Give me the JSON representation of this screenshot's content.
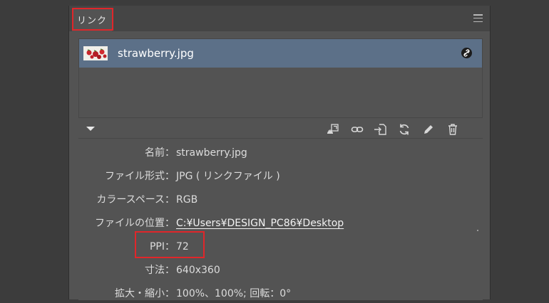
{
  "panel": {
    "tab_label": "リンク"
  },
  "file_list": {
    "items": [
      {
        "name": "strawberry.jpg"
      }
    ]
  },
  "toolbar": {
    "icons": [
      "relink-from-cc-icon",
      "relink-icon",
      "place-icon",
      "update-icon",
      "edit-original-icon",
      "delete-icon"
    ]
  },
  "info": {
    "name": {
      "label": "名前：",
      "value": "strawberry.jpg"
    },
    "format": {
      "label": "ファイル形式：",
      "value": "JPG ( リンクファイル )"
    },
    "colorspace": {
      "label": "カラースペース：",
      "value": "RGB"
    },
    "location": {
      "label": "ファイルの位置：",
      "value": "C:¥Users¥DESIGN_PC86¥Desktop"
    },
    "ppi": {
      "label": "PPI：",
      "value": "72"
    },
    "dimensions": {
      "label": "寸法：",
      "value": "640x360"
    },
    "scale": {
      "label": "拡大・縮小：",
      "value": "100%、100%; 回転：0°"
    }
  },
  "colors": {
    "highlight_red": "#e0262a",
    "selected_row": "#5c7088",
    "panel_bg": "#535353"
  }
}
